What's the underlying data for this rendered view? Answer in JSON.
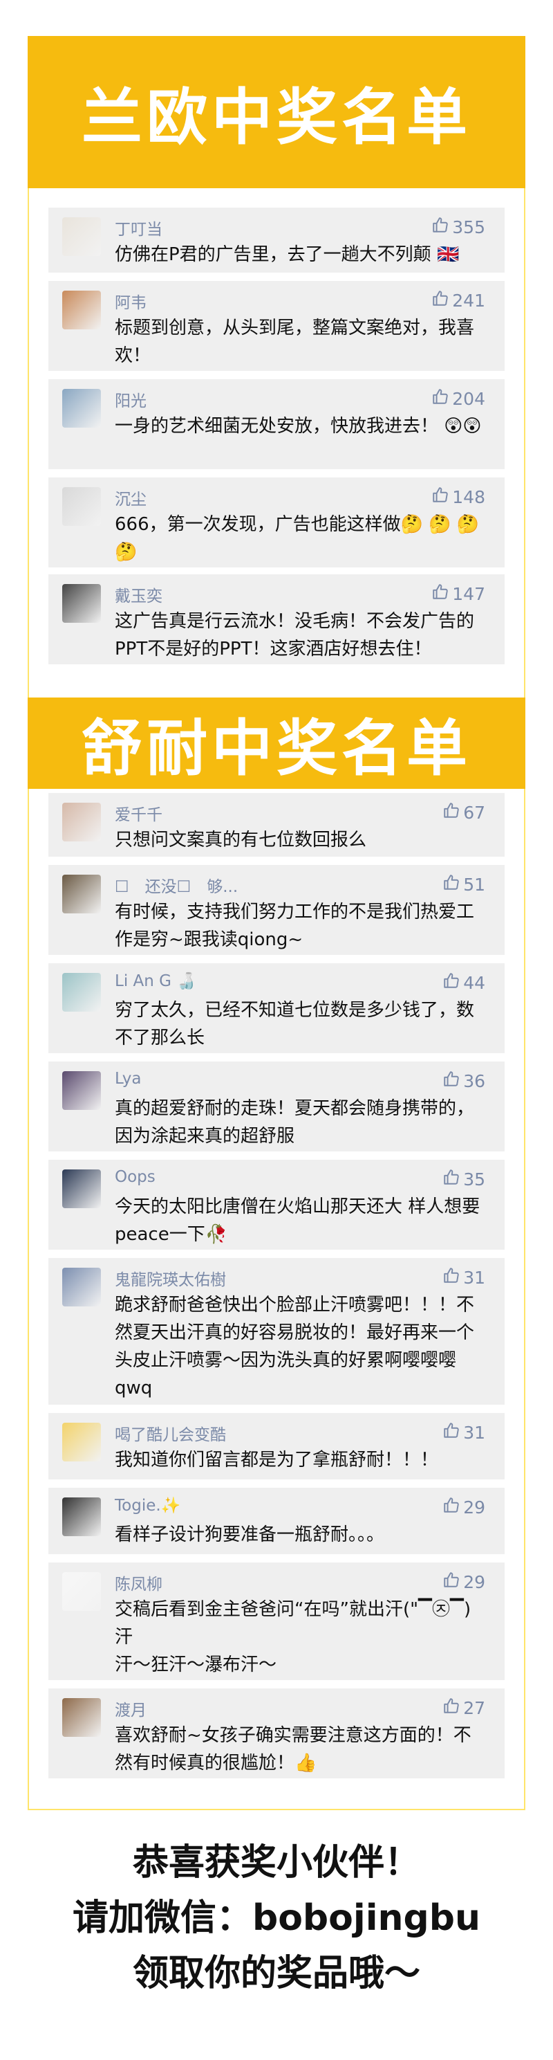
{
  "section1": {
    "title": "兰欧中奖名单",
    "comments": [
      {
        "name": "丁叮当",
        "likes": "355",
        "text": "仿佛在P君的广告里，去了一趟大不列颠 🇬🇧"
      },
      {
        "name": "阿韦",
        "likes": "241",
        "text": "标题到创意，从头到尾，整篇文案绝对，我喜欢！"
      },
      {
        "name": "阳光",
        "likes": "204",
        "text": "一身的艺术细菌无处安放，快放我进去！ 😲😲"
      },
      {
        "name": "沉尘",
        "likes": "148",
        "text": "666，第一次发现，广告也能这样做🤔 🤔 🤔 🤔"
      },
      {
        "name": "戴玉奕",
        "likes": "147",
        "text": "这广告真是行云流水！没毛病！不会发广告的PPT不是好的PPT！这家酒店好想去住！"
      }
    ]
  },
  "section2": {
    "title": "舒耐中奖名单",
    "comments": [
      {
        "name": "爱千千",
        "likes": "67",
        "text": "只想问文案真的有七位数回报么"
      },
      {
        "name": "☐　还没☐　够...",
        "likes": "51",
        "text": "有时候，支持我们努力工作的不是我们热爱工作是穷~跟我读qiong~"
      },
      {
        "name": "Li An G 🍶",
        "likes": "44",
        "text": "穷了太久，已经不知道七位数是多少钱了，数不了那么长"
      },
      {
        "name": "Lya",
        "likes": "36",
        "text": "真的超爱舒耐的走珠！夏天都会随身携带的，因为涂起来真的超舒服"
      },
      {
        "name": "Oops",
        "likes": "35",
        "text": "今天的太阳比唐僧在火焰山那天还大 样人想要peace一下🥀"
      },
      {
        "name": "鬼龍院瑛太佑樹",
        "likes": "31",
        "text": "跪求舒耐爸爸快出个脸部止汗喷雾吧！！！不然夏天出汗真的好容易脱妆的！最好再来一个头皮止汗喷雾～因为洗头真的好累啊嘤嘤嘤qwq"
      },
      {
        "name": "喝了酷儿会变酷",
        "likes": "31",
        "text": "我知道你们留言都是为了拿瓶舒耐！！！"
      },
      {
        "name": "Togie.✨",
        "likes": "29",
        "text": "看样子设计狗要准备一瓶舒耐。。。"
      },
      {
        "name": "陈凤柳",
        "likes": "29",
        "text": "交稿后看到金主爸爸问“在吗”就出汗(\"▔㉨▔)汗",
        "text2": "汗～狂汗～瀑布汗～"
      },
      {
        "name": "渡月",
        "likes": "27",
        "text": "喜欢舒耐~女孩子确实需要注意这方面的！不然有时候真的很尴尬！👍"
      }
    ]
  },
  "footer": {
    "line1": "恭喜获奖小伙伴！",
    "line2": "请加微信：bobojingbu",
    "line3": "领取你的奖品哦～"
  },
  "colors": {
    "accent": "#f6bb0f",
    "name": "#7b8aa8",
    "card": "#efefef"
  },
  "icons": {
    "like": "thumbs-up-icon"
  }
}
